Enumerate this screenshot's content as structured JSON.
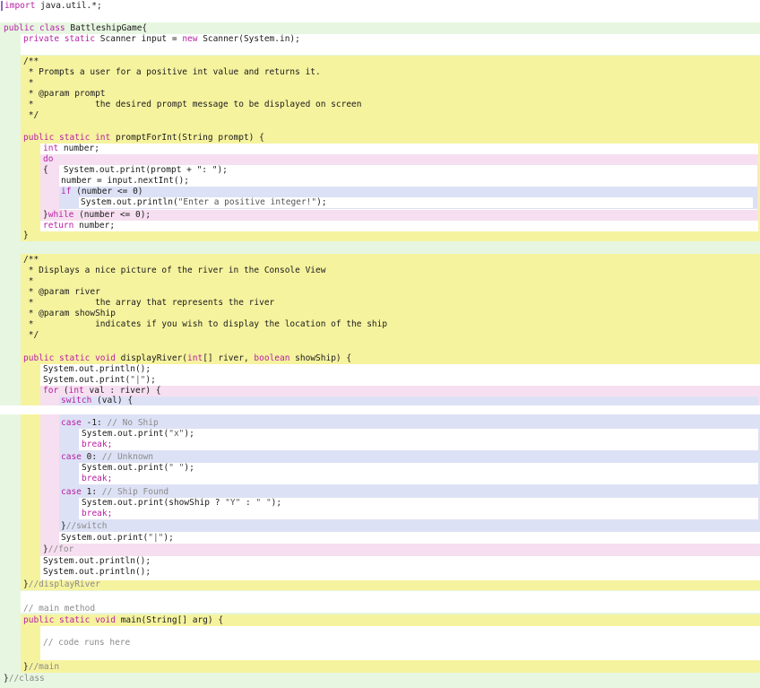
{
  "code": {
    "line_import": "import java.util.*;",
    "class_decl": "public class BattleshipGame{",
    "scanner_decl": "private static Scanner input = new Scanner(System.in);",
    "doc1": [
      "/**",
      " * Prompts a user for a positive int value and returns it.",
      " *",
      " * @param prompt",
      " *            the desired prompt message to be displayed on screen",
      " */"
    ],
    "method1_sig": "public static int promptForInt(String prompt) {",
    "int_number": "int number;",
    "do_kw": "do",
    "do_line1": "{   System.out.print(prompt + \": \");",
    "do_line2": "number = input.nextInt();",
    "if_line": "if (number <= 0)",
    "println_enter": "System.out.println(\"Enter a positive integer!\");",
    "while_line": "}while (number <= 0);",
    "return_line": "return number;",
    "close_brace": "}",
    "doc2": [
      "/**",
      " * Displays a nice picture of the river in the Console View",
      " *",
      " * @param river",
      " *            the array that represents the river",
      " * @param showShip",
      " *            indicates if you wish to display the location of the ship",
      " */"
    ],
    "method2_sig": "public static void displayRiver(int[] river, boolean showShip) {",
    "println_empty": "System.out.println();",
    "print_bar": "System.out.print(\"|\");",
    "for_line": "for (int val : river) {",
    "switch_line": "switch (val) {",
    "case_neg1": "case -1: ",
    "case_neg1_comment": "// No Ship",
    "print_x": "System.out.print(\"x\");",
    "break_kw": "break;",
    "case_0": "case 0: ",
    "case_0_comment": "// Unknown",
    "print_space": "System.out.print(\" \");",
    "case_1": "case 1: ",
    "case_1_comment": "// Ship Found",
    "print_ship": "System.out.print(showShip ? \"Y\" : \" \");",
    "end_switch": "//switch",
    "end_for": "//for",
    "end_display": "//displayRiver",
    "main_comment": "// main method",
    "main_sig": "public static void main(String[] arg) {",
    "code_runs_here": "// code runs here",
    "end_main": "//main",
    "end_class": "//class"
  }
}
